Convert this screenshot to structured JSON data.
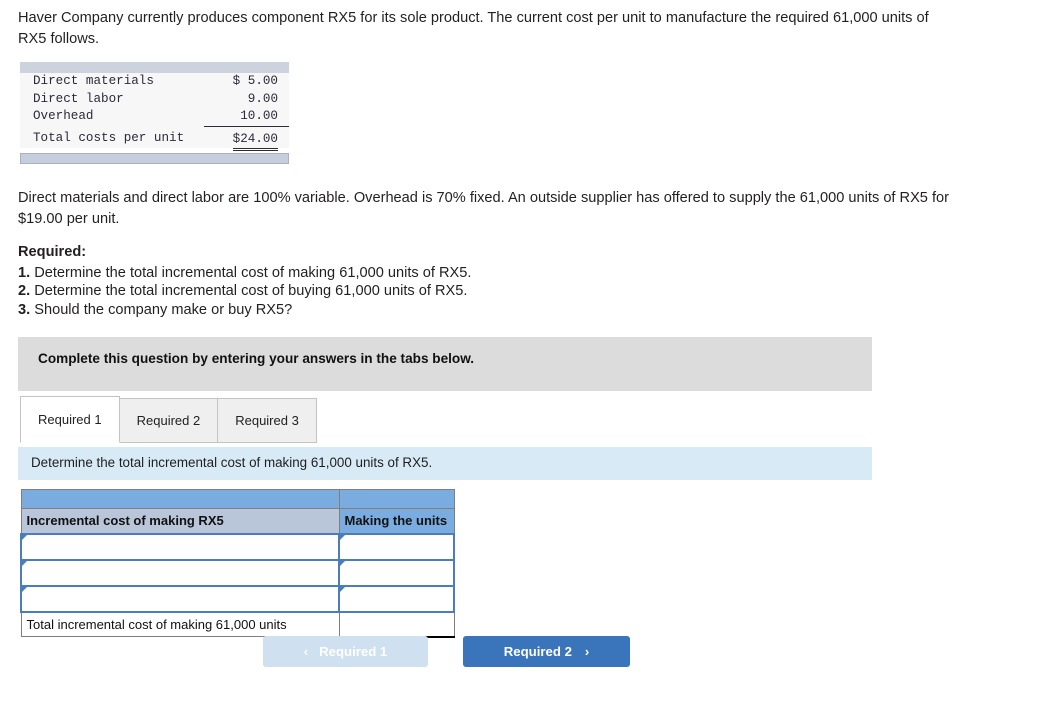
{
  "problem": {
    "intro": "Haver Company currently produces component RX5 for its sole product. The current cost per unit to manufacture the required 61,000 units of RX5 follows.",
    "variable_paragraph": "Direct materials and direct labor are 100% variable. Overhead is 70% fixed. An outside supplier has offered to supply the 61,000 units of RX5 for $19.00 per unit."
  },
  "cost_table": {
    "rows": [
      {
        "label": "Direct materials",
        "amount": "$ 5.00"
      },
      {
        "label": "Direct labor",
        "amount": "9.00"
      },
      {
        "label": "Overhead",
        "amount": "10.00"
      }
    ],
    "total": {
      "label": "Total costs per unit",
      "amount": "$24.00"
    }
  },
  "required": {
    "title": "Required:",
    "items": [
      {
        "num": "1.",
        "text": " Determine the total incremental cost of making 61,000 units of RX5."
      },
      {
        "num": "2.",
        "text": " Determine the total incremental cost of buying 61,000 units of RX5."
      },
      {
        "num": "3.",
        "text": " Should the company make or buy RX5?"
      }
    ]
  },
  "banner": {
    "text": "Complete this question by entering your answers in the tabs below."
  },
  "tabs": [
    {
      "label": "Required 1",
      "active": true
    },
    {
      "label": "Required 2",
      "active": false
    },
    {
      "label": "Required 3",
      "active": false
    }
  ],
  "instruction_strip": {
    "text": "Determine the total incremental cost of making 61,000 units of RX5."
  },
  "answer_table": {
    "header_left": "Incremental cost of making RX5",
    "header_right": "Making the units",
    "input_rows": [
      {
        "left_value": "",
        "right_value": ""
      },
      {
        "left_value": "",
        "right_value": ""
      },
      {
        "left_value": "",
        "right_value": ""
      }
    ],
    "total_row": {
      "label": "Total incremental cost of making 61,000 units",
      "value": ""
    }
  },
  "navigation": {
    "prev_label": "Required 1",
    "prev_chevron": "‹",
    "next_label": "Required 2",
    "next_chevron": "›"
  },
  "colors": {
    "header_blue": "#7aacdf",
    "header_grey_blue": "#b9c5d9",
    "input_border_blue": "#4a7ebb",
    "strip_blue": "#d9eaf7",
    "banner_grey": "#dcdcdc",
    "button_blue": "#3a75bb",
    "button_disabled_blue": "#cfe0f0"
  }
}
